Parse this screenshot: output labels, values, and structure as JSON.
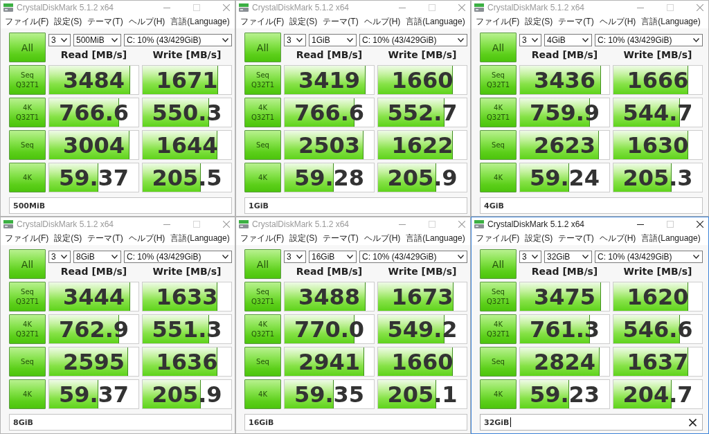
{
  "windows": [
    {
      "title": "CrystalDiskMark 5.1.2 x64",
      "active": false,
      "menu": [
        "ファイル(F)",
        "設定(S)",
        "テーマ(T)",
        "ヘルプ(H)",
        "言語(Language)"
      ],
      "all_button": "All",
      "count_select": "3",
      "size_select": "500MiB",
      "drive_select": "C: 10% (43/429GiB)",
      "columns": [
        "Read [MB/s]",
        "Write [MB/s]"
      ],
      "rows": [
        {
          "label": "Seq Q32T1",
          "read": {
            "value": "3484",
            "level": 0.91
          },
          "write": {
            "value": "1671",
            "level": 0.85
          }
        },
        {
          "label": "4K Q32T1",
          "read": {
            "value": "766.6",
            "level": 0.78
          },
          "write": {
            "value": "550.3",
            "level": 0.75
          }
        },
        {
          "label": "Seq",
          "read": {
            "value": "3004",
            "level": 0.9
          },
          "write": {
            "value": "1644",
            "level": 0.84
          }
        },
        {
          "label": "4K",
          "read": {
            "value": "59.37",
            "level": 0.55
          },
          "write": {
            "value": "205.5",
            "level": 0.66
          }
        }
      ],
      "comment": {
        "value": "500MiB",
        "focused": false
      }
    },
    {
      "title": "CrystalDiskMark 5.1.2 x64",
      "active": false,
      "menu": [
        "ファイル(F)",
        "設定(S)",
        "テーマ(T)",
        "ヘルプ(H)",
        "言語(Language)"
      ],
      "all_button": "All",
      "count_select": "3",
      "size_select": "1GiB",
      "drive_select": "C: 10% (43/429GiB)",
      "columns": [
        "Read [MB/s]",
        "Write [MB/s]"
      ],
      "rows": [
        {
          "label": "Seq Q32T1",
          "read": {
            "value": "3419",
            "level": 0.91
          },
          "write": {
            "value": "1660",
            "level": 0.84
          }
        },
        {
          "label": "4K Q32T1",
          "read": {
            "value": "766.6",
            "level": 0.78
          },
          "write": {
            "value": "552.7",
            "level": 0.75
          }
        },
        {
          "label": "Seq",
          "read": {
            "value": "2503",
            "level": 0.88
          },
          "write": {
            "value": "1622",
            "level": 0.84
          }
        },
        {
          "label": "4K",
          "read": {
            "value": "59.28",
            "level": 0.55
          },
          "write": {
            "value": "205.9",
            "level": 0.66
          }
        }
      ],
      "comment": {
        "value": "1GiB",
        "focused": false
      }
    },
    {
      "title": "CrystalDiskMark 5.1.2 x64",
      "active": false,
      "menu": [
        "ファイル(F)",
        "設定(S)",
        "テーマ(T)",
        "ヘルプ(H)",
        "言語(Language)"
      ],
      "all_button": "All",
      "count_select": "3",
      "size_select": "4GiB",
      "drive_select": "C: 10% (43/429GiB)",
      "columns": [
        "Read [MB/s]",
        "Write [MB/s]"
      ],
      "rows": [
        {
          "label": "Seq Q32T1",
          "read": {
            "value": "3436",
            "level": 0.91
          },
          "write": {
            "value": "1666",
            "level": 0.84
          }
        },
        {
          "label": "4K Q32T1",
          "read": {
            "value": "759.9",
            "level": 0.78
          },
          "write": {
            "value": "544.7",
            "level": 0.75
          }
        },
        {
          "label": "Seq",
          "read": {
            "value": "2623",
            "level": 0.88
          },
          "write": {
            "value": "1630",
            "level": 0.84
          }
        },
        {
          "label": "4K",
          "read": {
            "value": "59.24",
            "level": 0.55
          },
          "write": {
            "value": "205.3",
            "level": 0.66
          }
        }
      ],
      "comment": {
        "value": "4GiB",
        "focused": false
      }
    },
    {
      "title": "CrystalDiskMark 5.1.2 x64",
      "active": false,
      "menu": [
        "ファイル(F)",
        "設定(S)",
        "テーマ(T)",
        "ヘルプ(H)",
        "言語(Language)"
      ],
      "all_button": "All",
      "count_select": "3",
      "size_select": "8GiB",
      "drive_select": "C: 10% (43/429GiB)",
      "columns": [
        "Read [MB/s]",
        "Write [MB/s]"
      ],
      "rows": [
        {
          "label": "Seq Q32T1",
          "read": {
            "value": "3444",
            "level": 0.91
          },
          "write": {
            "value": "1633",
            "level": 0.84
          }
        },
        {
          "label": "4K Q32T1",
          "read": {
            "value": "762.9",
            "level": 0.78
          },
          "write": {
            "value": "551.3",
            "level": 0.75
          }
        },
        {
          "label": "Seq",
          "read": {
            "value": "2595",
            "level": 0.88
          },
          "write": {
            "value": "1636",
            "level": 0.84
          }
        },
        {
          "label": "4K",
          "read": {
            "value": "59.37",
            "level": 0.55
          },
          "write": {
            "value": "205.9",
            "level": 0.66
          }
        }
      ],
      "comment": {
        "value": "8GiB",
        "focused": false
      }
    },
    {
      "title": "CrystalDiskMark 5.1.2 x64",
      "active": false,
      "menu": [
        "ファイル(F)",
        "設定(S)",
        "テーマ(T)",
        "ヘルプ(H)",
        "言語(Language)"
      ],
      "all_button": "All",
      "count_select": "3",
      "size_select": "16GiB",
      "drive_select": "C: 10% (43/429GiB)",
      "columns": [
        "Read [MB/s]",
        "Write [MB/s]"
      ],
      "rows": [
        {
          "label": "Seq Q32T1",
          "read": {
            "value": "3488",
            "level": 0.91
          },
          "write": {
            "value": "1673",
            "level": 0.85
          }
        },
        {
          "label": "4K Q32T1",
          "read": {
            "value": "770.0",
            "level": 0.78
          },
          "write": {
            "value": "549.2",
            "level": 0.75
          }
        },
        {
          "label": "Seq",
          "read": {
            "value": "2941",
            "level": 0.89
          },
          "write": {
            "value": "1660",
            "level": 0.84
          }
        },
        {
          "label": "4K",
          "read": {
            "value": "59.35",
            "level": 0.55
          },
          "write": {
            "value": "205.1",
            "level": 0.66
          }
        }
      ],
      "comment": {
        "value": "16GiB",
        "focused": false
      }
    },
    {
      "title": "CrystalDiskMark 5.1.2 x64",
      "active": true,
      "menu": [
        "ファイル(F)",
        "設定(S)",
        "テーマ(T)",
        "ヘルプ(H)",
        "言語(Language)"
      ],
      "all_button": "All",
      "count_select": "3",
      "size_select": "32GiB",
      "drive_select": "C: 10% (43/429GiB)",
      "columns": [
        "Read [MB/s]",
        "Write [MB/s]"
      ],
      "rows": [
        {
          "label": "Seq Q32T1",
          "read": {
            "value": "3475",
            "level": 0.91
          },
          "write": {
            "value": "1620",
            "level": 0.84
          }
        },
        {
          "label": "4K Q32T1",
          "read": {
            "value": "761.3",
            "level": 0.78
          },
          "write": {
            "value": "546.6",
            "level": 0.75
          }
        },
        {
          "label": "Seq",
          "read": {
            "value": "2824",
            "level": 0.89
          },
          "write": {
            "value": "1637",
            "level": 0.84
          }
        },
        {
          "label": "4K",
          "read": {
            "value": "59.23",
            "level": 0.55
          },
          "write": {
            "value": "204.7",
            "level": 0.66
          }
        }
      ],
      "comment": {
        "value": "32GiB",
        "focused": true
      }
    }
  ]
}
